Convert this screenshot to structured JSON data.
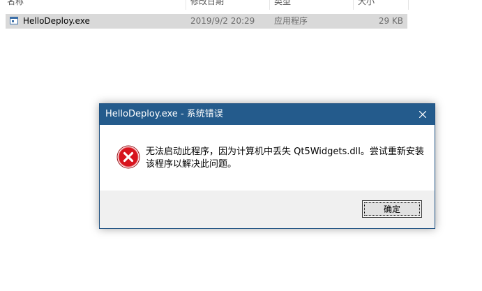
{
  "explorer": {
    "columns": {
      "name": "名称",
      "date": "修改日期",
      "type": "类型",
      "size": "大小"
    },
    "file": {
      "icon": "exe-file-icon",
      "name": "HelloDeploy.exe",
      "date": "2019/9/2 20:29",
      "type": "应用程序",
      "size": "29 KB"
    }
  },
  "dialog": {
    "title": "HelloDeploy.exe - 系统错误",
    "message": "无法启动此程序，因为计算机中丢失 Qt5Widgets.dll。尝试重新安装该程序以解决此问题。",
    "icon": "error-icon",
    "ok_label": "确定",
    "colors": {
      "titlebar": "#245b8c",
      "error_red": "#d7141e"
    }
  }
}
